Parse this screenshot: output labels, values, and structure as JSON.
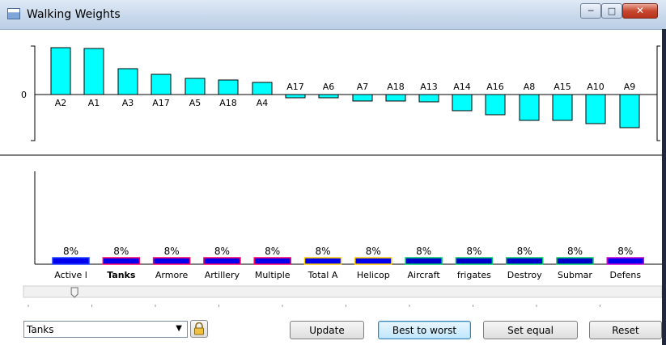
{
  "window": {
    "title": "Walking Weights",
    "controls": {
      "minimize": "minimize",
      "maximize": "maximize",
      "close": "close"
    }
  },
  "chart_data": [
    {
      "type": "bar",
      "zero_label": "0",
      "baseline_value": 0,
      "top_bars": [
        {
          "label": "A2",
          "value": 58
        },
        {
          "label": "A1",
          "value": 57
        },
        {
          "label": "A3",
          "value": 32
        },
        {
          "label": "A17",
          "value": 25
        },
        {
          "label": "A5",
          "value": 20
        },
        {
          "label": "A18",
          "value": 18
        },
        {
          "label": "A4",
          "value": 15
        }
      ],
      "bottom_bars": [
        {
          "label": "A17",
          "value": -4
        },
        {
          "label": "A6",
          "value": -4
        },
        {
          "label": "A7",
          "value": -8
        },
        {
          "label": "A18",
          "value": -8
        },
        {
          "label": "A13",
          "value": -9
        },
        {
          "label": "A14",
          "value": -20
        },
        {
          "label": "A16",
          "value": -25
        },
        {
          "label": "A8",
          "value": -32
        },
        {
          "label": "A15",
          "value": -32
        },
        {
          "label": "A10",
          "value": -36
        },
        {
          "label": "A9",
          "value": -41
        }
      ],
      "bar_color": "#00ffff"
    },
    {
      "type": "bar",
      "categories": [
        "Active l",
        "Tanks",
        "Armore",
        "Artillery",
        "Multiple",
        "Total A",
        "Helicop",
        "Aircraft",
        "frigates",
        "Destroy",
        "Submar",
        "Defens"
      ],
      "values": [
        8,
        8,
        8,
        8,
        8,
        8,
        8,
        8,
        8,
        8,
        8,
        8
      ],
      "value_labels": [
        "8%",
        "8%",
        "8%",
        "8%",
        "8%",
        "8%",
        "8%",
        "8%",
        "8%",
        "8%",
        "8%",
        "8%"
      ],
      "bold_category": "Tanks",
      "bar_colors": [
        "#0000ee",
        "#0000ee",
        "#0000ee",
        "#0000ee",
        "#0000ee",
        "#0000ee",
        "#0000ee",
        "#0000cc",
        "#0000cc",
        "#0000cc",
        "#0000cc",
        "#0000ee"
      ],
      "bar_borders": [
        "#2040ff",
        "#ff0066",
        "#ff0066",
        "#ff0066",
        "#ff0066",
        "#ffcc00",
        "#ffcc00",
        "#00cc66",
        "#00cc66",
        "#00cc66",
        "#00cc66",
        "#cc00cc"
      ]
    }
  ],
  "slider": {
    "value": 0.08
  },
  "controls": {
    "dropdown_value": "Tanks",
    "update_label": "Update",
    "best_to_worst_label": "Best to worst",
    "set_equal_label": "Set equal",
    "reset_label": "Reset"
  }
}
